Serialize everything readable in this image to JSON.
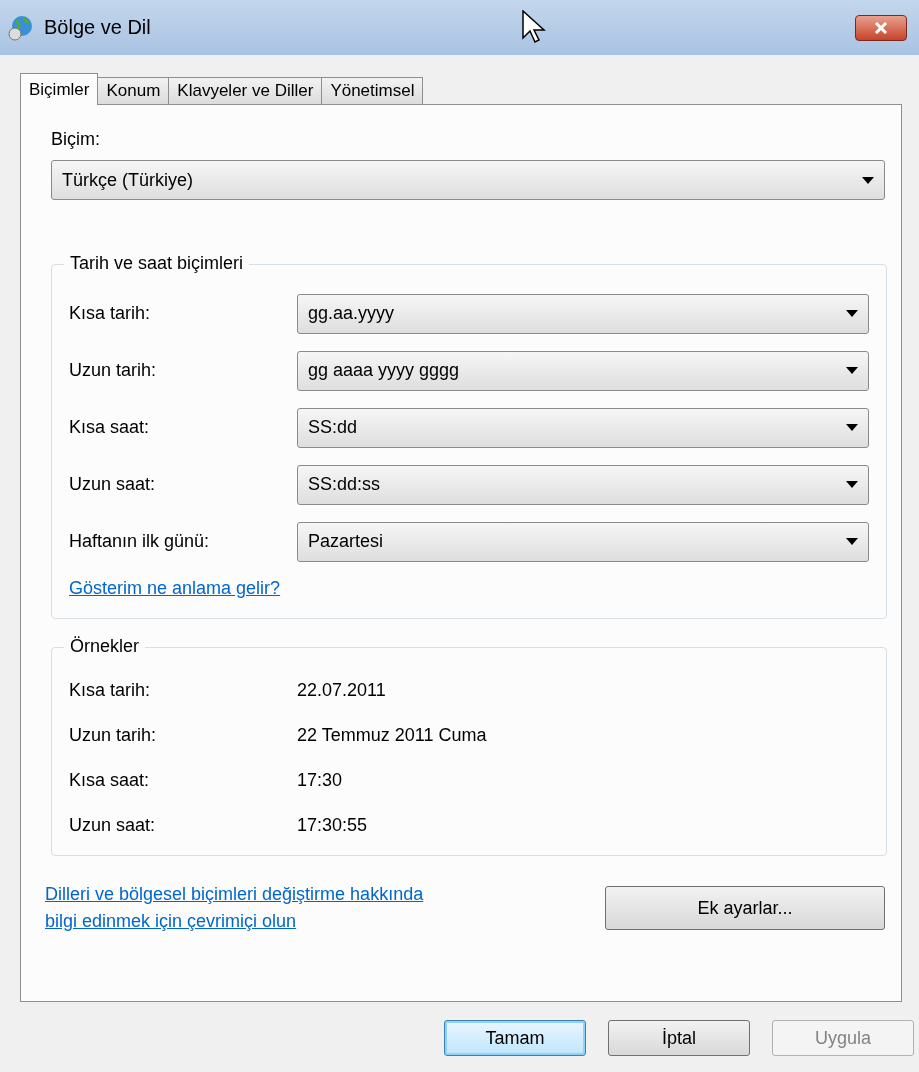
{
  "window": {
    "title": "Bölge ve Dil"
  },
  "tabs": [
    {
      "label": "Biçimler",
      "selected": true
    },
    {
      "label": "Konum",
      "selected": false
    },
    {
      "label": "Klavyeler ve Diller",
      "selected": false
    },
    {
      "label": "Yönetimsel",
      "selected": false
    }
  ],
  "format": {
    "label": "Biçim:",
    "value": "Türkçe (Türkiye)"
  },
  "date_time_formats": {
    "title": "Tarih ve saat biçimleri",
    "fields": [
      {
        "label": "Kısa tarih:",
        "value": "gg.aa.yyyy"
      },
      {
        "label": "Uzun tarih:",
        "value": "gg aaaa yyyy gggg"
      },
      {
        "label": "Kısa saat:",
        "value": "SS:dd"
      },
      {
        "label": "Uzun saat:",
        "value": "SS:dd:ss"
      },
      {
        "label": "Haftanın ilk günü:",
        "value": "Pazartesi"
      }
    ],
    "link": "Gösterim ne anlama gelir?"
  },
  "examples": {
    "title": "Örnekler",
    "rows": [
      {
        "label": "Kısa tarih:",
        "value": "22.07.2011"
      },
      {
        "label": "Uzun tarih:",
        "value": "22 Temmuz 2011 Cuma"
      },
      {
        "label": "Kısa saat:",
        "value": "17:30"
      },
      {
        "label": "Uzun saat:",
        "value": "17:30:55"
      }
    ]
  },
  "online_link": {
    "lines": [
      "Dilleri ve bölgesel biçimleri değiştirme hakkında",
      "bilgi edinmek için çevrimiçi olun"
    ]
  },
  "additional_settings_button": "Ek ayarlar...",
  "buttons": [
    {
      "label": "Tamam",
      "default": true,
      "disabled": false
    },
    {
      "label": "İptal",
      "default": false,
      "disabled": false
    },
    {
      "label": "Uygula",
      "default": false,
      "disabled": true
    }
  ]
}
